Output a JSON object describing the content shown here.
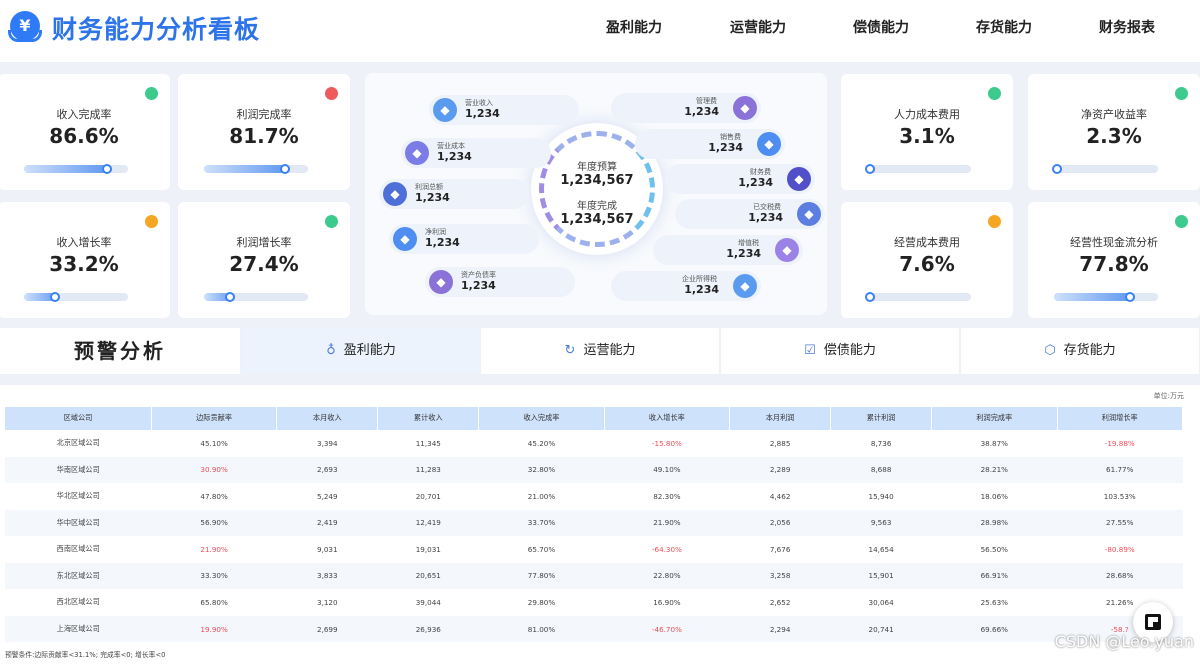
{
  "header": {
    "logo_glyph": "¥",
    "title": "财务能力分析看板",
    "nav": [
      "盈利能力",
      "运营能力",
      "偿债能力",
      "存货能力",
      "财务报表"
    ]
  },
  "metrics": [
    {
      "label": "收入完成率",
      "value": "86.6%",
      "status": "green",
      "progress": 0.85
    },
    {
      "label": "利润完成率",
      "value": "81.7%",
      "status": "red",
      "progress": 0.83
    },
    {
      "label": "收入增长率",
      "value": "33.2%",
      "status": "orange",
      "progress": 0.35
    },
    {
      "label": "利润增长率",
      "value": "27.4%",
      "status": "green",
      "progress": 0.3
    },
    {
      "label": "人力成本费用",
      "value": "3.1%",
      "status": "green",
      "progress": 0.05
    },
    {
      "label": "净资产收益率",
      "value": "2.3%",
      "status": "green",
      "progress": 0.05
    },
    {
      "label": "经营成本费用",
      "value": "7.6%",
      "status": "orange",
      "progress": 0.08
    },
    {
      "label": "经营性现金流分析",
      "value": "77.8%",
      "status": "green",
      "progress": 0.78
    }
  ],
  "colors": {
    "green": "#3dcb8d",
    "red": "#ef5b5b",
    "orange": "#f5a623",
    "accent": "#2d73ea"
  },
  "center": {
    "budget_label": "年度预算",
    "budget_value": "1,234,567",
    "done_label": "年度完成",
    "done_value": "1,234,567",
    "left": [
      {
        "label": "营业收入",
        "value": "1,234",
        "icon": "money-bag-icon",
        "color": "#5a9bf0"
      },
      {
        "label": "营业成本",
        "value": "1,234",
        "icon": "document-icon",
        "color": "#7b7ce8"
      },
      {
        "label": "利润总额",
        "value": "1,234",
        "icon": "database-icon",
        "color": "#4f6fd8"
      },
      {
        "label": "净利润",
        "value": "1,234",
        "icon": "chart-icon",
        "color": "#4d8ef0"
      },
      {
        "label": "资产负债率",
        "value": "1,234",
        "icon": "calculator-icon",
        "color": "#8a72d8"
      }
    ],
    "right": [
      {
        "label": "管理费",
        "value": "1,234",
        "icon": "calendar-icon",
        "color": "#8a72d8"
      },
      {
        "label": "销售费",
        "value": "1,234",
        "icon": "bar-chart-icon",
        "color": "#4d8ef0"
      },
      {
        "label": "财务费",
        "value": "1,234",
        "icon": "safe-icon",
        "color": "#5150c8"
      },
      {
        "label": "已交税费",
        "value": "1,234",
        "icon": "stamp-icon",
        "color": "#5b7ee0"
      },
      {
        "label": "增值税",
        "value": "1,234",
        "icon": "coins-icon",
        "color": "#9b82e6"
      },
      {
        "label": "企业所得税",
        "value": "1,234",
        "icon": "report-icon",
        "color": "#5a9bf0"
      }
    ]
  },
  "tabs": {
    "title": "预警分析",
    "items": [
      {
        "label": "盈利能力",
        "icon": "money-bag-icon",
        "glyph": "♁"
      },
      {
        "label": "运营能力",
        "icon": "refresh-icon",
        "glyph": "↻"
      },
      {
        "label": "偿债能力",
        "icon": "chart-line-icon",
        "glyph": "☑"
      },
      {
        "label": "存货能力",
        "icon": "box-icon",
        "glyph": "⬡"
      }
    ]
  },
  "table": {
    "unit": "单位:万元",
    "headers": [
      "区域公司",
      "边际贡献率",
      "本月收入",
      "累计收入",
      "收入完成率",
      "收入增长率",
      "本月利润",
      "累计利润",
      "利润完成率",
      "利润增长率"
    ],
    "rows": [
      [
        "北京区域公司",
        "45.10%",
        "3,394",
        "11,345",
        "45.20%",
        "-15.80%",
        "2,885",
        "8,736",
        "38.87%",
        "-19.88%"
      ],
      [
        "华南区域公司",
        "30.90%",
        "2,693",
        "11,283",
        "32.80%",
        "49.10%",
        "2,289",
        "8,688",
        "28.21%",
        "61.77%"
      ],
      [
        "华北区域公司",
        "47.80%",
        "5,249",
        "20,701",
        "21.00%",
        "82.30%",
        "4,462",
        "15,940",
        "18.06%",
        "103.53%"
      ],
      [
        "华中区域公司",
        "56.90%",
        "2,419",
        "12,419",
        "33.70%",
        "21.90%",
        "2,056",
        "9,563",
        "28.98%",
        "27.55%"
      ],
      [
        "西南区域公司",
        "21.90%",
        "9,031",
        "19,031",
        "65.70%",
        "-64.30%",
        "7,676",
        "14,654",
        "56.50%",
        "-80.89%"
      ],
      [
        "东北区域公司",
        "33.30%",
        "3,833",
        "20,651",
        "77.80%",
        "22.80%",
        "3,258",
        "15,901",
        "66.91%",
        "28.68%"
      ],
      [
        "西北区域公司",
        "65.80%",
        "3,120",
        "39,044",
        "29.80%",
        "16.90%",
        "2,652",
        "30,064",
        "25.63%",
        "21.26%"
      ],
      [
        "上海区域公司",
        "19.90%",
        "2,699",
        "26,936",
        "81.00%",
        "-46.70%",
        "2,294",
        "20,741",
        "69.66%",
        "-58.?"
      ]
    ],
    "footnote": "预警条件:边际贡献率<31.1%; 完成率<0; 增长率<0"
  },
  "watermark": "CSDN @Leo.yuan"
}
